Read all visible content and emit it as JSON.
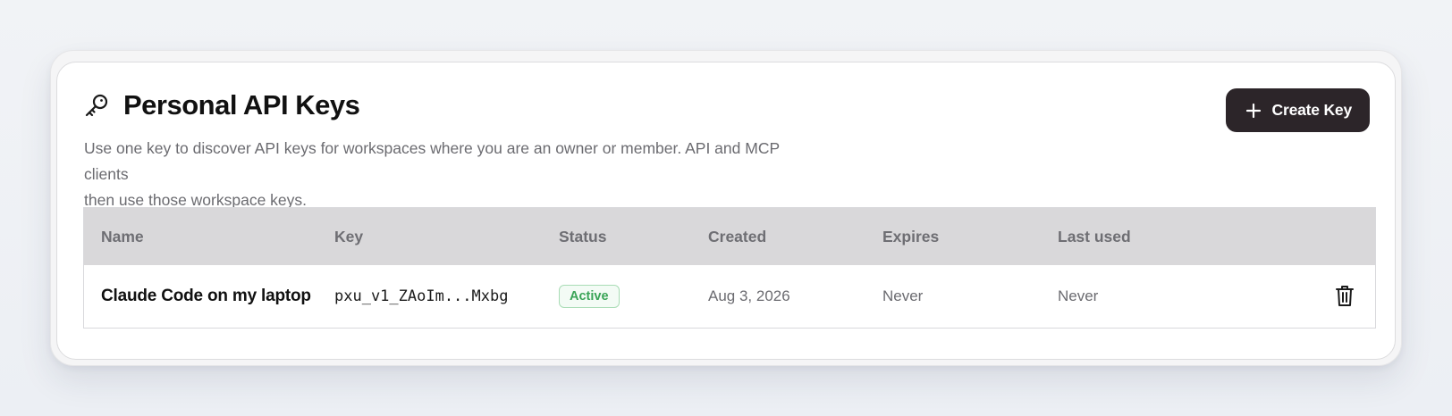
{
  "header": {
    "title": "Personal API Keys",
    "description_line1": "Use one key to discover API keys for workspaces where you are an owner or member. API and MCP clients",
    "description_line2": "then use those workspace keys.",
    "icon": "key-icon"
  },
  "actions": {
    "create_label": "Create Key",
    "create_icon": "plus-icon"
  },
  "table": {
    "columns": [
      "Name",
      "Key",
      "Status",
      "Created",
      "Expires",
      "Last used"
    ],
    "rows": [
      {
        "name": "Claude Code on my laptop",
        "key": "pxu_v1_ZAoIm...Mxbg",
        "status": "Active",
        "created": "Aug 3, 2026",
        "expires": "Never",
        "last_used": "Never",
        "delete_icon": "trash-icon"
      }
    ]
  },
  "colors": {
    "button_bg": "#2c2529",
    "status_active": "#3aa457",
    "header_bg": "#d9d8da"
  }
}
